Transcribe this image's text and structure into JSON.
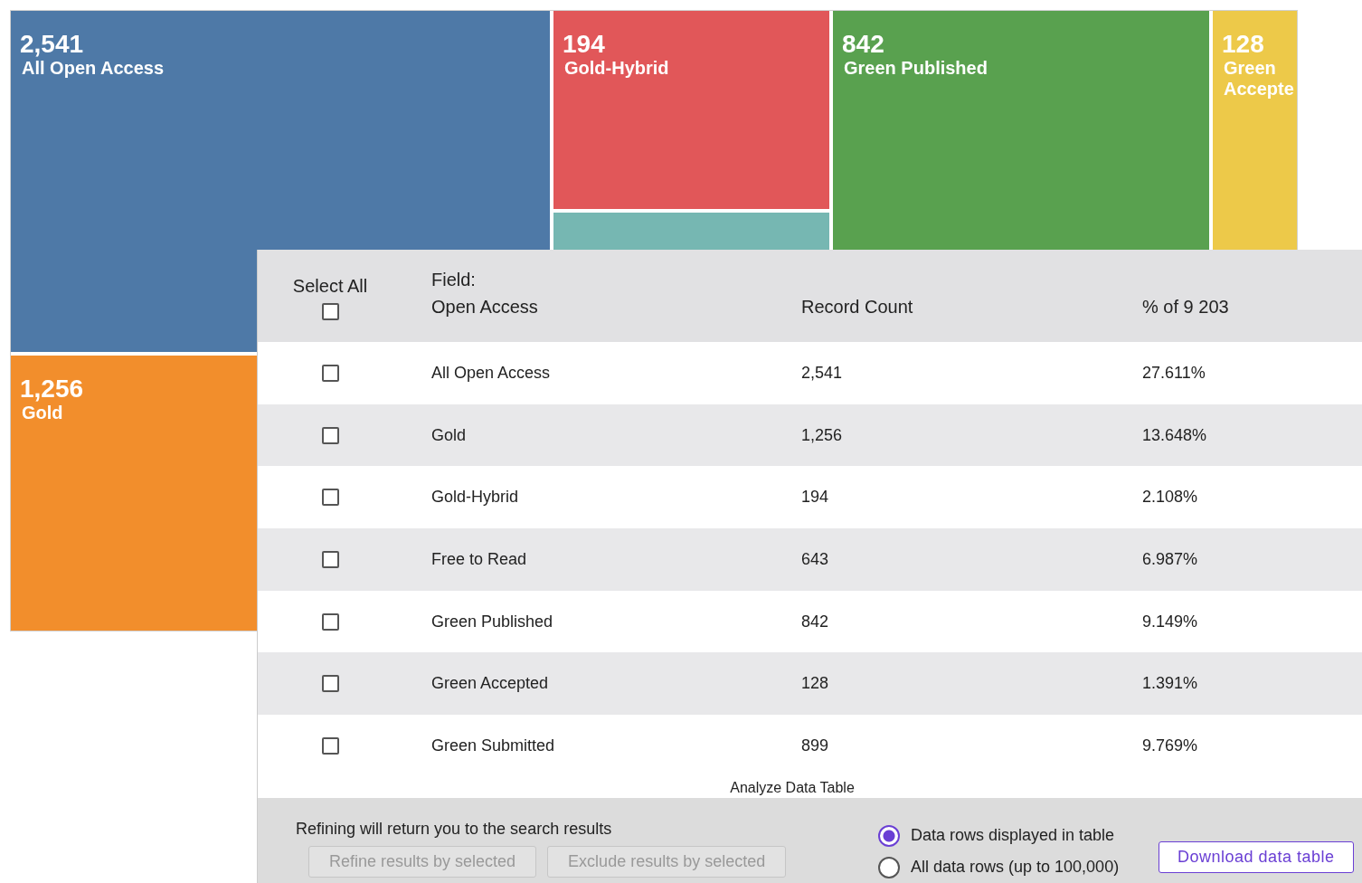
{
  "treemap": {
    "columns": [
      {
        "tiles": [
          {
            "value": "2,541",
            "label": "All Open Access",
            "color": "#4e79a7"
          },
          {
            "value": "1,256",
            "label": "Gold",
            "color": "#f28e2c"
          }
        ]
      },
      {
        "tiles": [
          {
            "value": "194",
            "label": "Gold-Hybrid",
            "color": "#e15759"
          },
          {
            "color": "#76b7b2"
          }
        ]
      },
      {
        "tiles": [
          {
            "value": "842",
            "label": "Green Published",
            "color": "#59a14f"
          }
        ]
      },
      {
        "tiles": [
          {
            "value": "128",
            "label": "Green Accepte",
            "color": "#edc949"
          }
        ]
      }
    ]
  },
  "table": {
    "select_all": {
      "label": "Select All",
      "checked": false
    },
    "columns": [
      "Field:\nOpen Access",
      "Record Count",
      "% of 9 203"
    ],
    "rows": [
      {
        "field": "All Open Access",
        "count": "2,541",
        "percent": "27.611%",
        "checked": false
      },
      {
        "field": "Gold",
        "count": "1,256",
        "percent": "13.648%",
        "checked": false
      },
      {
        "field": "Gold-Hybrid",
        "count": "194",
        "percent": "2.108%",
        "checked": false
      },
      {
        "field": "Free to Read",
        "count": "643",
        "percent": "6.987%",
        "checked": false
      },
      {
        "field": "Green Published",
        "count": "842",
        "percent": "9.149%",
        "checked": false
      },
      {
        "field": "Green Accepted",
        "count": "128",
        "percent": "1.391%",
        "checked": false
      },
      {
        "field": "Green Submitted",
        "count": "899",
        "percent": "9.769%",
        "checked": false
      }
    ],
    "caption": "Analyze Data Table"
  },
  "footer": {
    "note": "Refining will return you to the search results",
    "buttons": [
      {
        "label": "Refine results by selected",
        "disabled": true
      },
      {
        "label": "Exclude results by selected",
        "disabled": true
      }
    ],
    "options": [
      {
        "label": "Data rows displayed in table",
        "selected": true
      },
      {
        "label": "All data rows (up to 100,000)",
        "selected": false
      }
    ],
    "download": "Download data table"
  }
}
